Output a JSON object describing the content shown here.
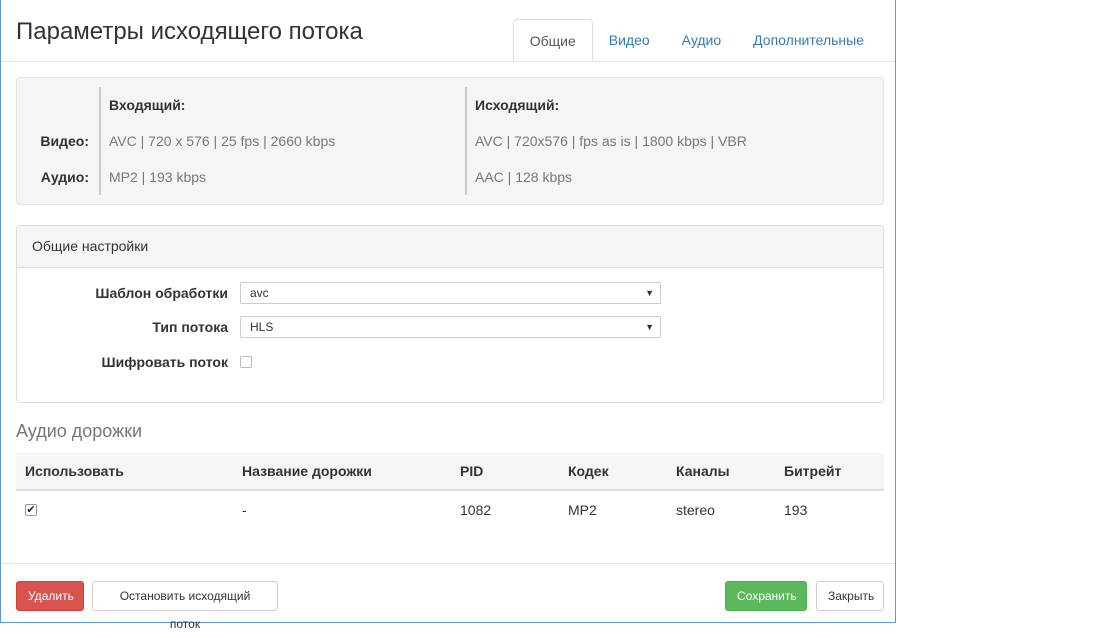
{
  "header": {
    "title": "Параметры исходящего потока",
    "tabs": [
      {
        "label": "Общие",
        "active": true
      },
      {
        "label": "Видео",
        "active": false
      },
      {
        "label": "Аудио",
        "active": false
      },
      {
        "label": "Дополнительные",
        "active": false
      }
    ]
  },
  "summary": {
    "incoming_header": "Входящий:",
    "outgoing_header": "Исходящий:",
    "video_label": "Видео:",
    "audio_label": "Аудио:",
    "incoming_video": "AVC | 720 x 576 | 25 fps | 2660 kbps",
    "incoming_audio": "MP2 | 193 kbps",
    "outgoing_video": "AVC | 720x576 | fps as is | 1800 kbps | VBR",
    "outgoing_audio": "AAC | 128 kbps"
  },
  "general": {
    "title": "Общие настройки",
    "template_label": "Шаблон обработки",
    "template_value": "avc",
    "stream_type_label": "Тип потока",
    "stream_type_value": "HLS",
    "encrypt_label": "Шифровать поток",
    "encrypt_checked": false
  },
  "audio_tracks": {
    "title": "Аудио дорожки",
    "columns": [
      "Использовать",
      "Название дорожки",
      "PID",
      "Кодек",
      "Каналы",
      "Битрейт"
    ],
    "rows": [
      {
        "use": true,
        "name": "-",
        "pid": "1082",
        "codec": "MP2",
        "channels": "stereo",
        "bitrate": "193"
      }
    ]
  },
  "footer": {
    "delete_label": "Удалить",
    "stop_label": "Остановить исходящий поток",
    "save_label": "Сохранить",
    "close_label": "Закрыть"
  },
  "colors": {
    "accent": "#337ab7",
    "danger": "#d9534f",
    "success": "#5cb85c",
    "window_border": "#5b9bd5"
  },
  "icons": {
    "dropdown_arrow": "▼",
    "checkmark": "✔"
  }
}
